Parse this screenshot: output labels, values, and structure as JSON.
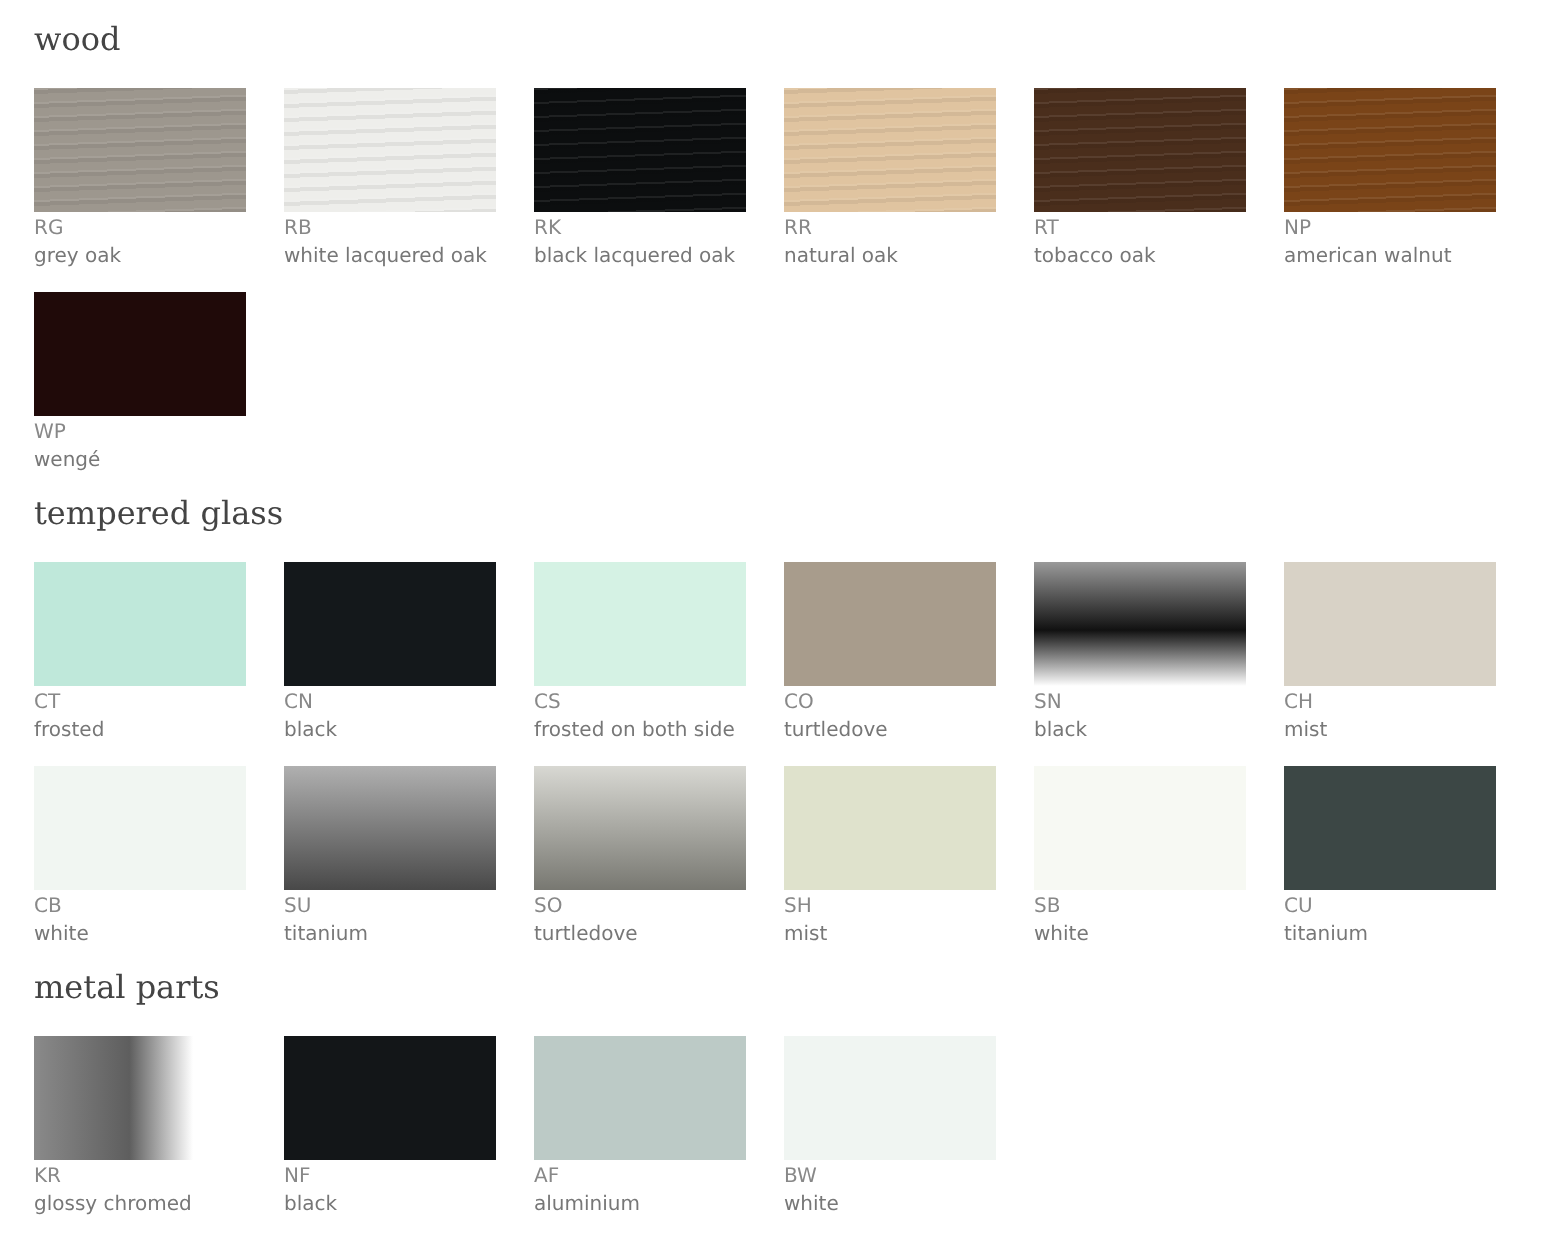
{
  "sections": [
    {
      "title": "wood",
      "items": [
        {
          "code": "RG",
          "name": "grey oak",
          "color": "#9d978e",
          "kind": "grain"
        },
        {
          "code": "RB",
          "name": "white lacquered oak",
          "color": "#eeeeeb",
          "kind": "grain"
        },
        {
          "code": "RK",
          "name": "black lacquered oak",
          "color": "#0c0e0f",
          "kind": "grain"
        },
        {
          "code": "RR",
          "name": "natural oak",
          "color": "#e0c4a0",
          "kind": "grain"
        },
        {
          "code": "RT",
          "name": "tobacco oak",
          "color": "#4a2e1c",
          "kind": "grain"
        },
        {
          "code": "NP",
          "name": "american walnut",
          "color": "#7a4418",
          "kind": "grain"
        },
        {
          "code": "WP",
          "name": "wengé",
          "color": "#200a09",
          "kind": "plain"
        }
      ]
    },
    {
      "title": "tempered glass",
      "items": [
        {
          "code": "CT",
          "name": "frosted",
          "color": "#bfe8da",
          "kind": "plain"
        },
        {
          "code": "CN",
          "name": "black",
          "color": "#14181b",
          "kind": "plain"
        },
        {
          "code": "CS",
          "name": "frosted on both side",
          "color": "#d5f2e4",
          "kind": "plain"
        },
        {
          "code": "CO",
          "name": "turtledove",
          "color": "#a89c8c",
          "kind": "plain"
        },
        {
          "code": "SN",
          "name": "black",
          "color": "#3a3a3a",
          "kind": "mirror"
        },
        {
          "code": "CH",
          "name": "mist",
          "color": "#d8d2c6",
          "kind": "plain"
        },
        {
          "code": "CB",
          "name": "white",
          "color": "#f1f6f2",
          "kind": "plain"
        },
        {
          "code": "SU",
          "name": "titanium",
          "color": "#6f6f6f",
          "kind": "fade"
        },
        {
          "code": "SO",
          "name": "turtledove",
          "color": "#b8b8ae",
          "kind": "fade"
        },
        {
          "code": "SH",
          "name": "mist",
          "color": "#dfe2cc",
          "kind": "plain"
        },
        {
          "code": "SB",
          "name": "white",
          "color": "#f7f9f3",
          "kind": "plain"
        },
        {
          "code": "CU",
          "name": "titanium",
          "color": "#3c4745",
          "kind": "plain"
        }
      ]
    },
    {
      "title": "metal parts",
      "items": [
        {
          "code": "KR",
          "name": "glossy chromed",
          "color": "#808080",
          "kind": "chrome"
        },
        {
          "code": "NF",
          "name": "black",
          "color": "#131618",
          "kind": "plain"
        },
        {
          "code": "AF",
          "name": "aluminium",
          "color": "#bccac6",
          "kind": "plain"
        },
        {
          "code": "BW",
          "name": "white",
          "color": "#f0f5f2",
          "kind": "plain"
        }
      ]
    }
  ]
}
